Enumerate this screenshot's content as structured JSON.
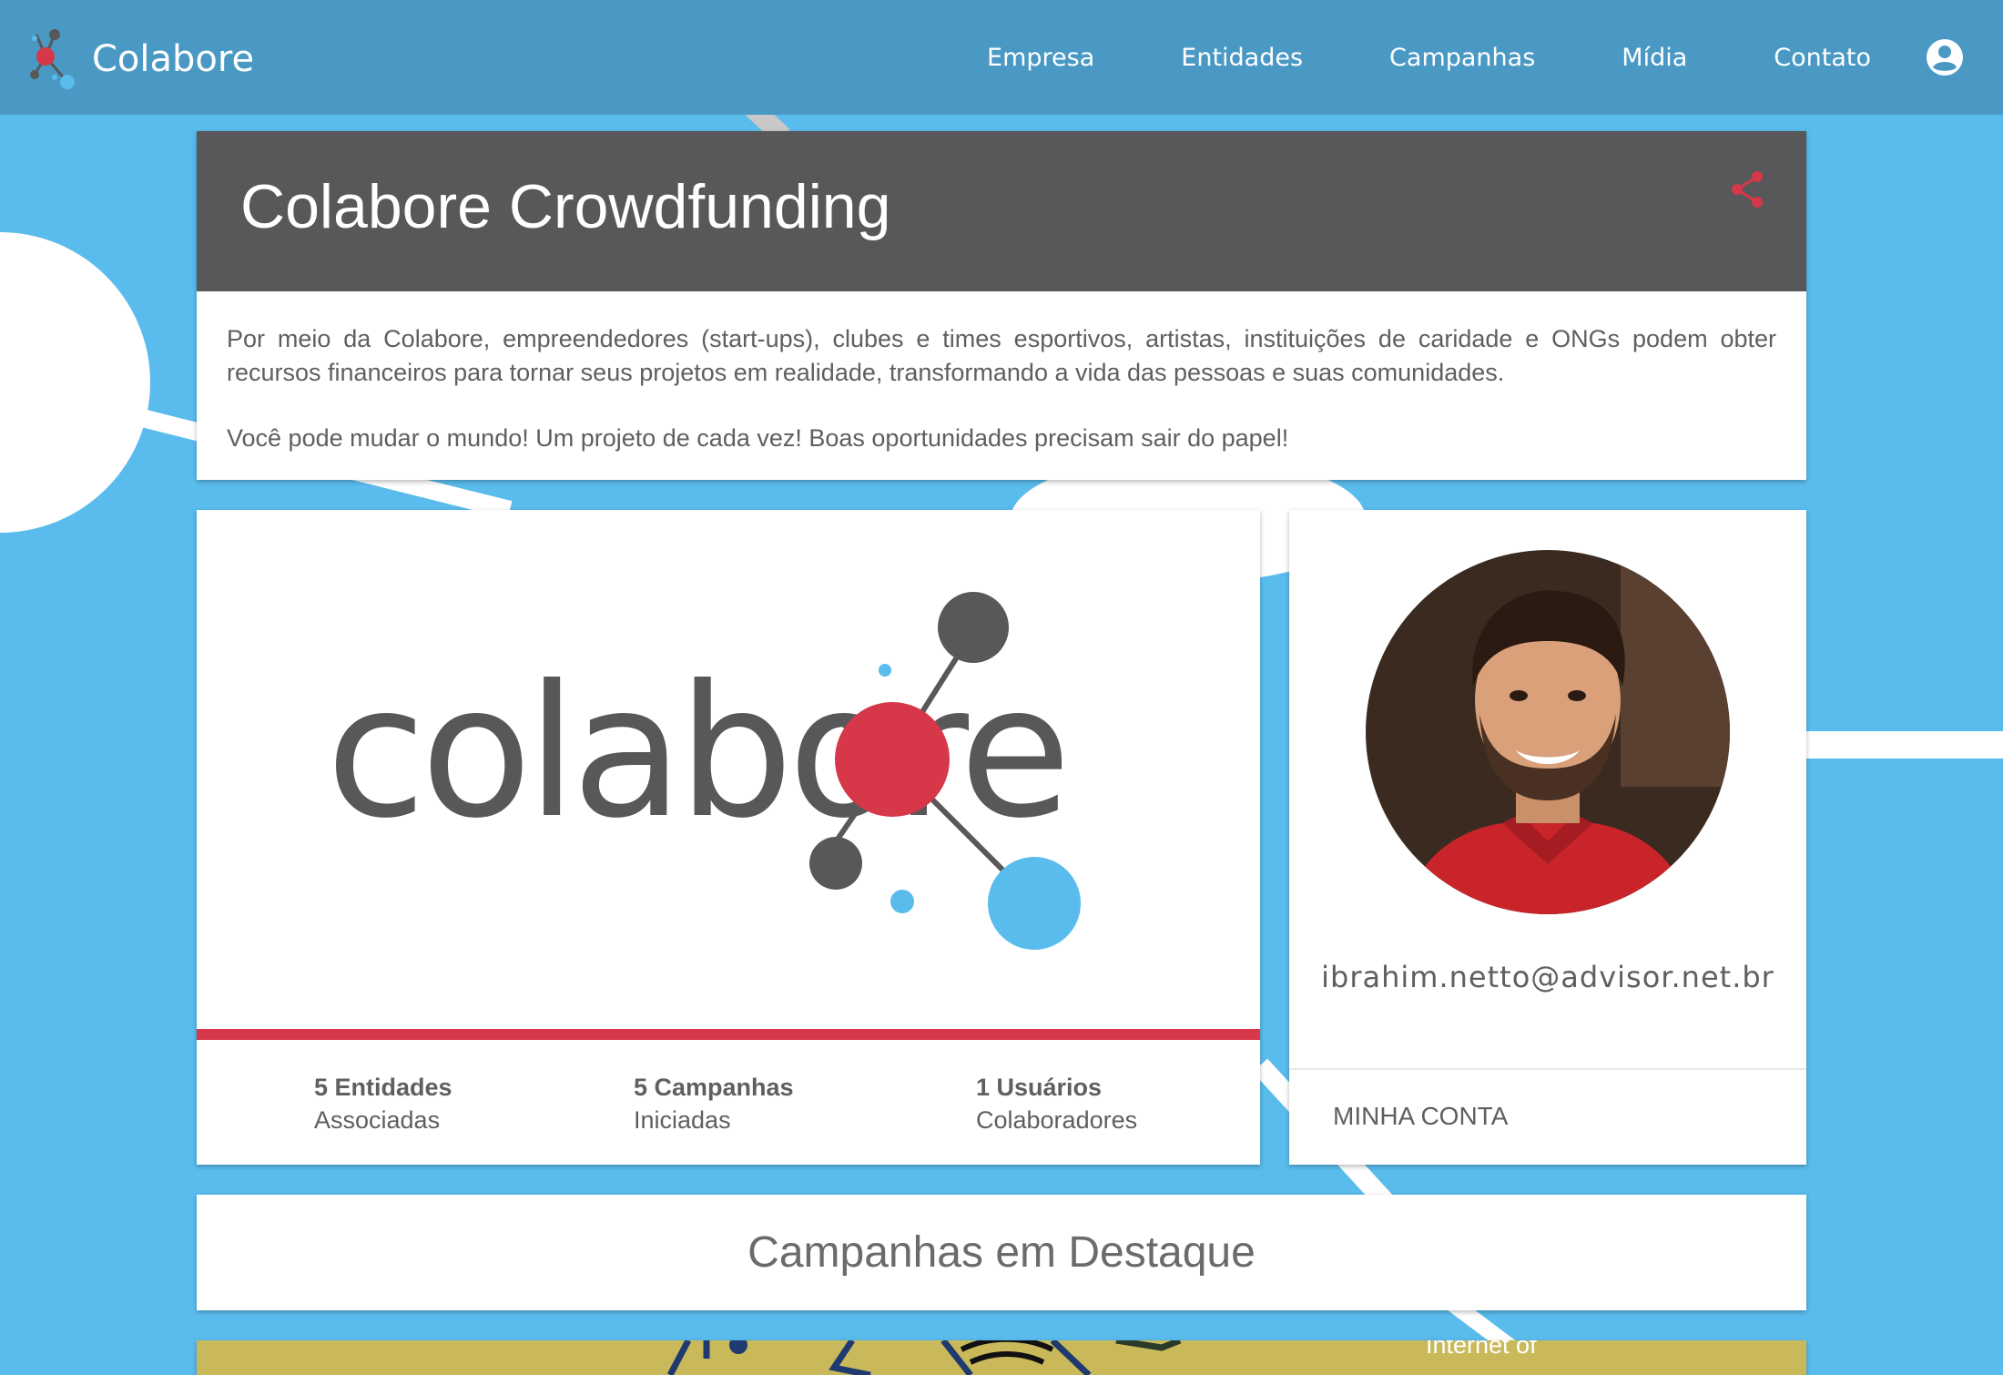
{
  "app": {
    "name": "Colabore"
  },
  "nav": {
    "items": [
      {
        "label": "Empresa"
      },
      {
        "label": "Entidades"
      },
      {
        "label": "Campanhas"
      },
      {
        "label": "Mídia"
      },
      {
        "label": "Contato"
      }
    ],
    "account_icon": "account-circle-icon"
  },
  "header": {
    "title": "Colabore Crowdfunding",
    "share_icon": "share-icon",
    "paragraphs": [
      "Por meio da Colabore, empreendedores (start-ups), clubes e times esportivos, artistas, instituições de caridade e ONGs podem obter recursos financeiros para tornar seus projetos em realidade, transformando a vida das pessoas e suas comunidades.",
      "Você pode mudar o mundo! Um projeto de cada vez! Boas oportunidades precisam sair do papel!"
    ]
  },
  "logo_card": {
    "logo_text": "colabore",
    "stats": [
      {
        "value": "5 Entidades",
        "label": "Associadas"
      },
      {
        "value": "5 Campanhas",
        "label": "Iniciadas"
      },
      {
        "value": "1 Usuários",
        "label": "Colaboradores"
      }
    ]
  },
  "profile": {
    "email": "ibrahim.netto@advisor.net.br",
    "account_button": "MINHA CONTA"
  },
  "featured": {
    "title": "Campanhas em Destaque",
    "campaign_preview_text": "Internet of"
  },
  "colors": {
    "background": "#5abced",
    "topbar": "#4a99c4",
    "header": "#58585a",
    "accent_red": "#d63749",
    "logo_gray": "#58585a",
    "logo_blue": "#5abced"
  }
}
